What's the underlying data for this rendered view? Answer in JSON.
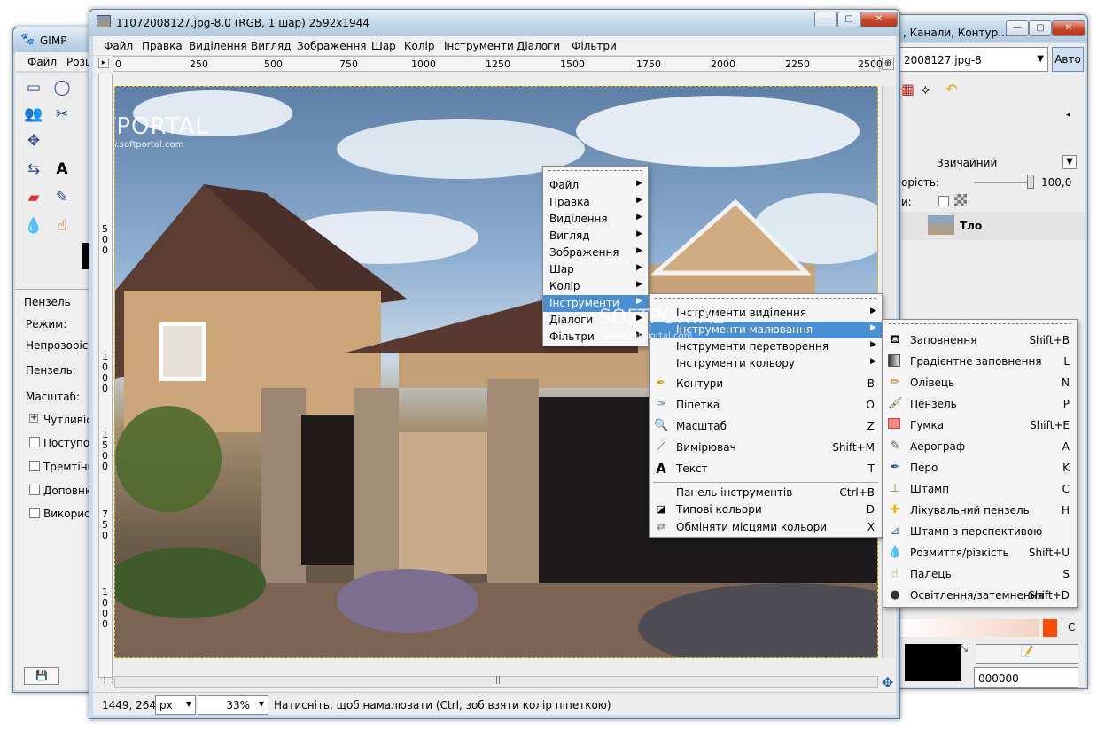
{
  "watermark": {
    "brand": "SOFTPORTAL",
    "url": "www.softportal.com"
  },
  "toolbox": {
    "title": "GIMP",
    "menu": [
      "Файл",
      "Розщ"
    ],
    "tool_options": {
      "header": "Пензель",
      "mode": "Режим:",
      "opacity": "Непрозорість",
      "brush": "Пензель:",
      "scale": "Масштаб:",
      "options": [
        "Чутливіст",
        "Поступов",
        "Тремтінн",
        "Доповню",
        "Використ"
      ]
    }
  },
  "layers": {
    "title": ", Канали, Контур...",
    "image_select": "2008127.jpg-8",
    "auto_button": "Авто",
    "mode": "Звичайний",
    "opacity_label": "орість:",
    "opacity_value": "100,0",
    "lock_label": "и:",
    "layer_name": "Тло",
    "color_hex": "000000"
  },
  "image_window": {
    "title": "11072008127.jpg-8.0 (RGB, 1 шар) 2592x1944",
    "menu": [
      "Файл",
      "Правка",
      "Виділення",
      "Вигляд",
      "Зображення",
      "Шар",
      "Колір",
      "Інструменти",
      "Діалоги",
      "Фільтри"
    ],
    "ruler_ticks": [
      "250",
      "500",
      "750",
      "1000",
      "1250",
      "1500",
      "1750",
      "2000",
      "2250",
      "2500"
    ],
    "ruler_origin": "0",
    "vertical_ticks": [
      "5",
      "0",
      "0",
      "1",
      "0",
      "0",
      "0",
      "1",
      "5",
      "0",
      "0",
      "7",
      "5",
      "0",
      "1",
      "0",
      "0",
      "0"
    ],
    "status": {
      "coords": "1449, 264",
      "unit": "px",
      "zoom": "33%",
      "message": "Натисніть, щоб намалювати (Ctrl, зоб взяти колір піпеткою)"
    }
  },
  "context_menu": {
    "items": [
      "Файл",
      "Правка",
      "Виділення",
      "Вигляд",
      "Зображення",
      "Шар",
      "Колір",
      "Інструменти",
      "Діалоги",
      "Фільтри"
    ],
    "highlighted": "Інструменти"
  },
  "tools_submenu": {
    "groups": [
      "Інструменти виділення",
      "Інструменти малювання",
      "Інструменти перетворення",
      "Інструменти кольору"
    ],
    "tools": [
      {
        "label": "Контури",
        "key": "B",
        "icon": "paths-icon"
      },
      {
        "label": "Піпетка",
        "key": "O",
        "icon": "eyedropper-icon"
      },
      {
        "label": "Масштаб",
        "key": "Z",
        "icon": "zoom-icon"
      },
      {
        "label": "Вимірювач",
        "key": "Shift+M",
        "icon": "measure-icon"
      },
      {
        "label": "Текст",
        "key": "T",
        "icon": "text-icon"
      }
    ],
    "extra": [
      {
        "label": "Панель інструментів",
        "key": "Ctrl+B",
        "icon": ""
      },
      {
        "label": "Типові кольори",
        "key": "D",
        "icon": "default-colors-icon"
      },
      {
        "label": "Обміняти місцями кольори",
        "key": "X",
        "icon": "swap-colors-icon"
      }
    ]
  },
  "paint_submenu": {
    "items": [
      {
        "label": "Заповнення",
        "key": "Shift+B",
        "icon": "bucket-fill-icon"
      },
      {
        "label": "Градієнтне заповнення",
        "key": "L",
        "icon": "gradient-icon"
      },
      {
        "label": "Олівець",
        "key": "N",
        "icon": "pencil-icon"
      },
      {
        "label": "Пензель",
        "key": "P",
        "icon": "paintbrush-icon"
      },
      {
        "label": "Гумка",
        "key": "Shift+E",
        "icon": "eraser-icon"
      },
      {
        "label": "Аерограф",
        "key": "A",
        "icon": "airbrush-icon"
      },
      {
        "label": "Перо",
        "key": "K",
        "icon": "ink-icon"
      },
      {
        "label": "Штамп",
        "key": "C",
        "icon": "clone-icon"
      },
      {
        "label": "Лікувальний пензель",
        "key": "H",
        "icon": "heal-icon"
      },
      {
        "label": "Штамп з перспективою",
        "key": "",
        "icon": "perspective-clone-icon"
      },
      {
        "label": "Розмиття/різкість",
        "key": "Shift+U",
        "icon": "blur-icon"
      },
      {
        "label": "Палець",
        "key": "S",
        "icon": "smudge-icon"
      },
      {
        "label": "Освітлення/затемнення",
        "key": "Shift+D",
        "icon": "dodge-icon"
      }
    ]
  }
}
